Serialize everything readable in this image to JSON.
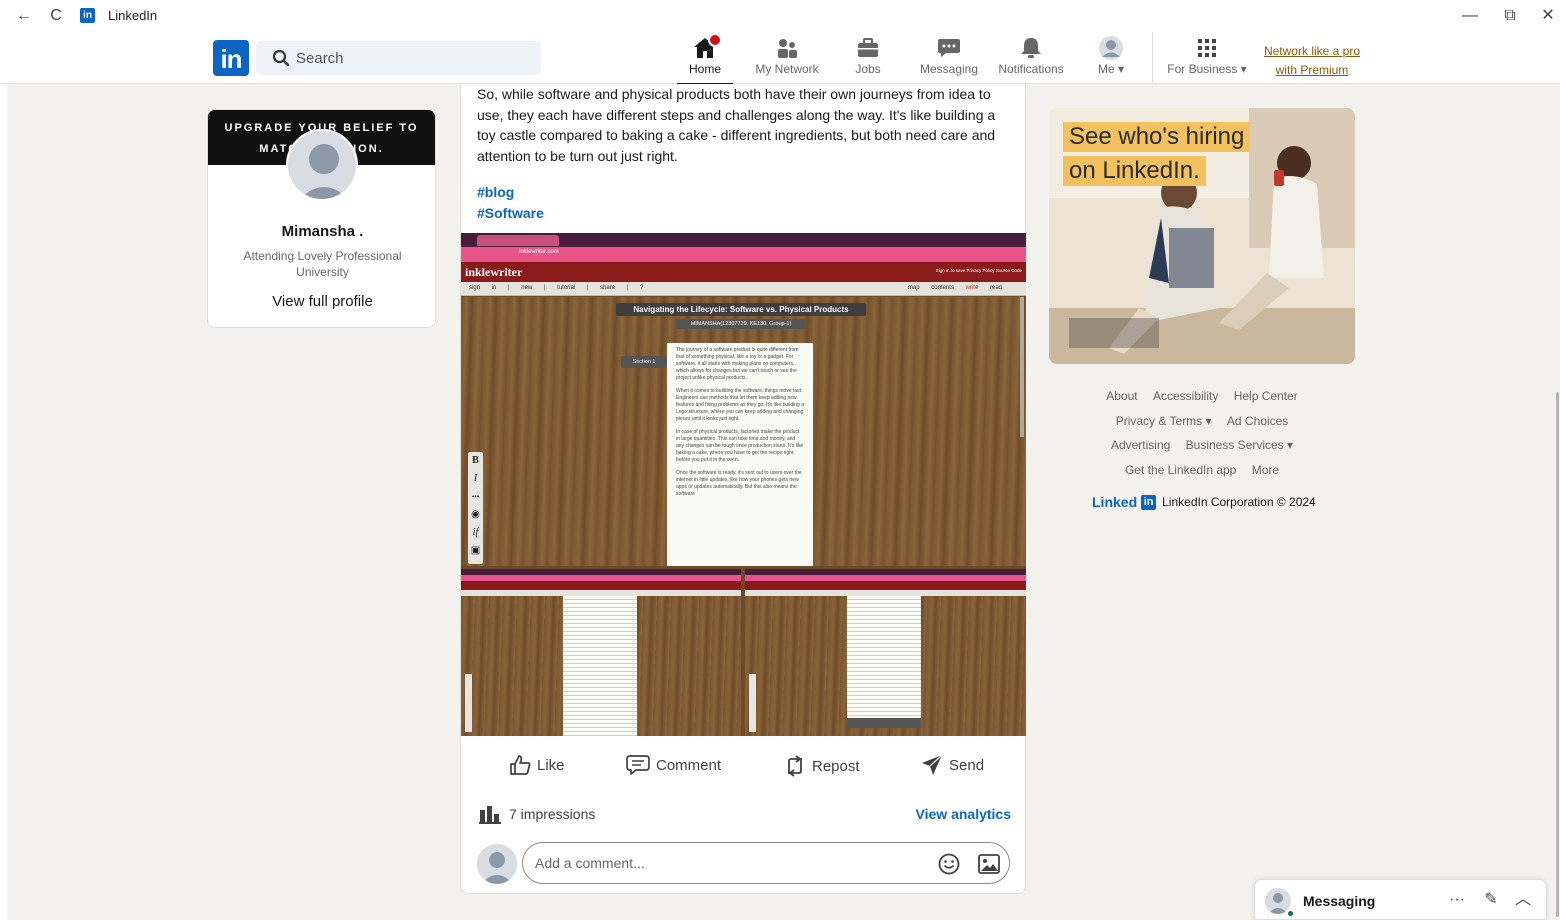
{
  "window": {
    "title": "LinkedIn",
    "back_icon": "←",
    "reload_icon": "C",
    "logo": "in",
    "min_icon": "—",
    "max_icon": "⧉",
    "close_icon": "✕"
  },
  "nav": {
    "logo": "in",
    "search_placeholder": "Search",
    "items": [
      {
        "label": "Home",
        "icon": "home-icon",
        "active": true
      },
      {
        "label": "My Network",
        "icon": "network-icon"
      },
      {
        "label": "Jobs",
        "icon": "briefcase-icon"
      },
      {
        "label": "Messaging",
        "icon": "chat-icon"
      },
      {
        "label": "Notifications",
        "icon": "bell-icon"
      },
      {
        "label": "Me",
        "icon": "avatar"
      },
      {
        "label": "For Business",
        "icon": "grid-icon"
      }
    ],
    "premium_line1": "Network like a pro",
    "premium_line2": "with Premium"
  },
  "profile": {
    "banner_line1": "UPGRADE YOUR BELIEF TO",
    "banner_line2": "MATC         SION.",
    "name": "Mimansha .",
    "subtitle": "Attending Lovely Professional University",
    "view_link": "View full profile"
  },
  "post": {
    "text": "So, while software and physical products both have their own journeys from idea to use, they each have different steps and challenges along the way. It's like building a toy castle compared to baking a cake - different ingredients, but both need care and attention to be turn out just right.",
    "hashtags": [
      "#blog",
      "#Software"
    ],
    "image": {
      "app_name": "inklewriter",
      "url_text": "inklewriter.com",
      "story_title": "Navigating the Lifecycle: Software vs. Physical Products",
      "author_line": "MIMANSHA(12307729, KE130, Group-1)",
      "section_label": "Section 1",
      "menu": [
        "sign in",
        "new",
        "tutorial",
        "share",
        "?"
      ],
      "right_menu": [
        "map",
        "contents",
        "write",
        "read"
      ],
      "top_right_links": "Sign in to save  Privacy Policy  Source Code",
      "format_tools": [
        "B",
        "I",
        "•••",
        "◉",
        "if",
        "▣"
      ],
      "paragraphs": [
        "The journey of a software product is quite different from that of something physical, like a toy or a gadget. For software, it all starts with making plans on computers, which allows for changes but we can't touch or see the project unlike physical products.",
        "When it comes to building the software, things move fast. Engineers use methods that let them keep adding new features and fixing problems as they go. It's like building a Lego structure, where you can keep adding and changing pieces until it looks just right.",
        "In case of physical products, factories make the product in large quantities. This can take time and money, and any changes can be tough once production starts. It's like baking a cake, where you have to get the recipe right before you put it in the oven.",
        "Once the software is ready, it's sent out to users over the internet in little updates, like how your phones gets new apps or updates automatically. But this also means the software"
      ]
    },
    "actions": [
      "Like",
      "Comment",
      "Repost",
      "Send"
    ],
    "impressions": "7 impressions",
    "analytics_link": "View analytics",
    "comment_placeholder": "Add a comment..."
  },
  "ad": {
    "line1": "See who's hiring",
    "line2": "on LinkedIn."
  },
  "footer": {
    "links": [
      [
        "About",
        "Accessibility",
        "Help Center"
      ],
      [
        "Privacy & Terms ▾",
        "Ad Choices"
      ],
      [
        "Advertising",
        "Business Services ▾"
      ],
      [
        "Get the LinkedIn app",
        "More"
      ]
    ],
    "brand_linked": "Linked",
    "brand_in": "in",
    "copyright": "LinkedIn Corporation © 2024"
  },
  "messaging": {
    "label": "Messaging",
    "more_icon": "···",
    "compose_icon": "✎",
    "collapse_icon": "︿"
  },
  "colors": {
    "brand": "#0a66c2",
    "background": "#f4f2ee",
    "premium": "#915907",
    "notification": "#cc1016"
  }
}
